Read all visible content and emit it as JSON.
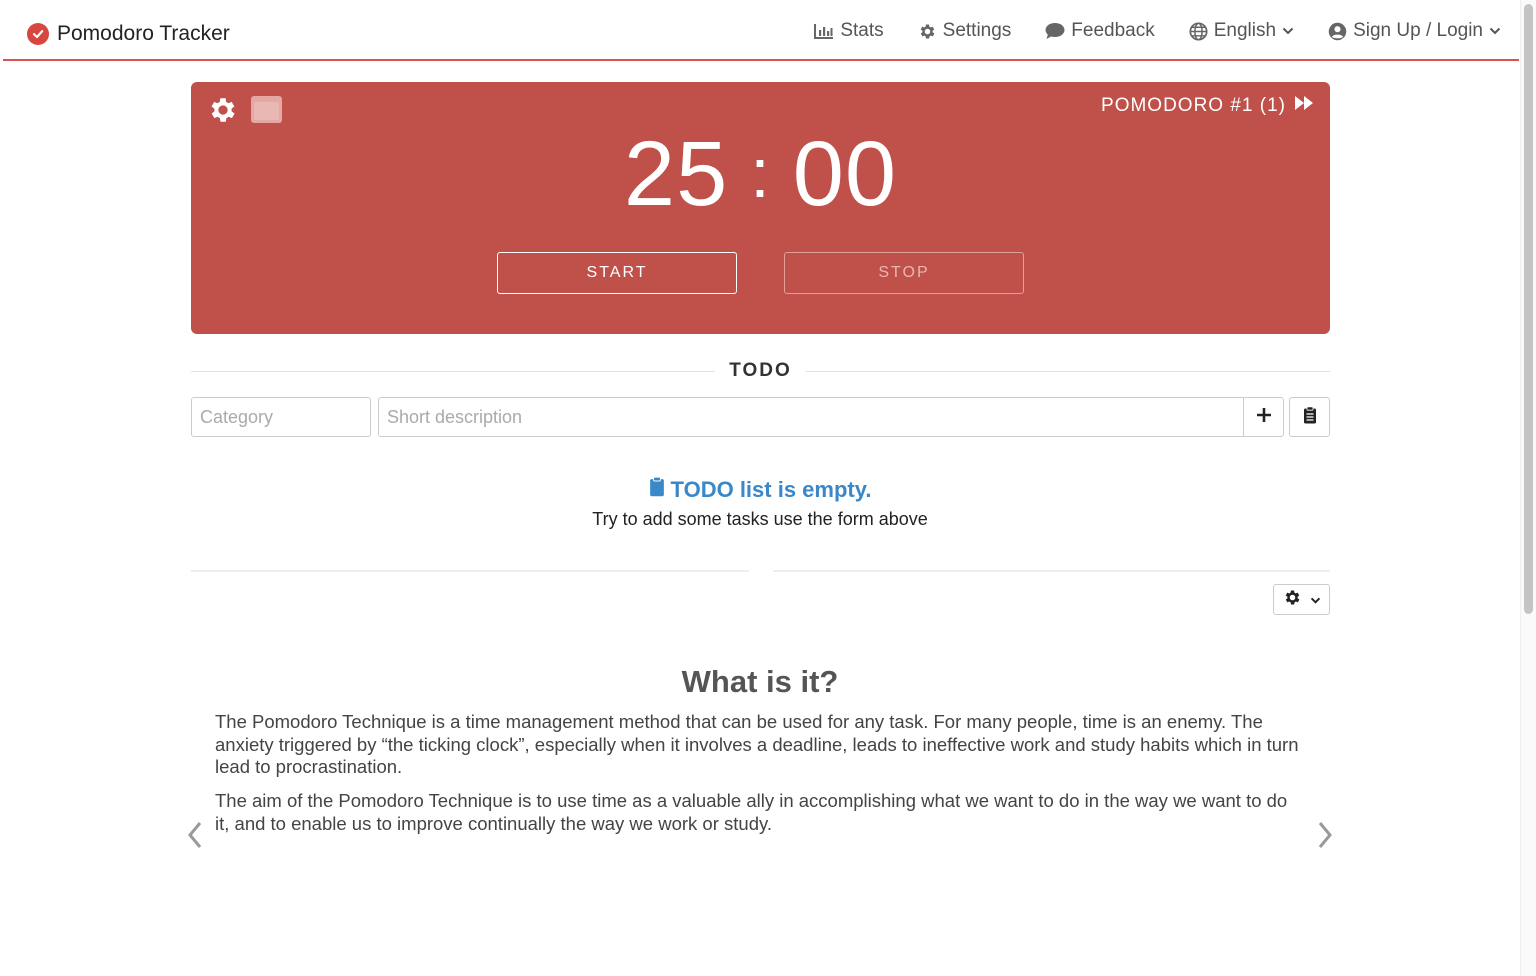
{
  "app": {
    "title": "Pomodoro Tracker"
  },
  "nav": {
    "stats": "Stats",
    "settings": "Settings",
    "feedback": "Feedback",
    "language": "English",
    "account": "Sign Up / Login"
  },
  "timer": {
    "label": "POMODORO #1 (1)",
    "minutes": "25",
    "separator": ":",
    "seconds": "00",
    "start_label": "START",
    "stop_label": "STOP",
    "panel_color": "#c0504a"
  },
  "todo": {
    "heading": "TODO",
    "category_placeholder": "Category",
    "description_placeholder": "Short description",
    "empty_title": "TODO list is empty.",
    "empty_subtitle": "Try to add some tasks use the form above"
  },
  "info": {
    "title": "What is it?",
    "paragraphs": [
      "The Pomodoro Technique is a time management method that can be used for any task. For many people, time is an enemy. The anxiety triggered by “the ticking clock”, especially when it involves a deadline, leads to ineffective work and study habits which in turn lead to procrastination.",
      "The aim of the Pomodoro Technique is to use time as a valuable ally in accomplishing what we want to do in the way we want to do it, and to enable us to improve continually the way we work or study."
    ]
  },
  "colors": {
    "accent": "#d9534f",
    "link_blue": "#3a87c9"
  }
}
